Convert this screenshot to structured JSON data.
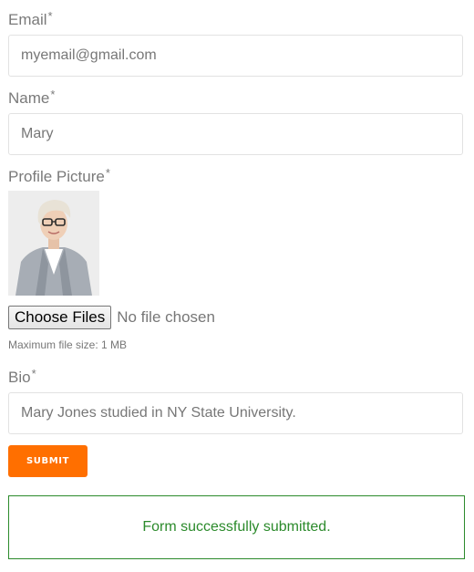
{
  "form": {
    "email": {
      "label": "Email",
      "required": "*",
      "value": "myemail@gmail.com"
    },
    "name": {
      "label": "Name",
      "required": "*",
      "value": "Mary"
    },
    "profile_picture": {
      "label": "Profile Picture",
      "required": "*",
      "choose_button": "Choose Files",
      "file_status": "No file chosen",
      "hint": "Maximum file size: 1 MB"
    },
    "bio": {
      "label": "Bio",
      "required": "*",
      "value": "Mary Jones studied in NY State University."
    },
    "submit_label": "SUBMIT",
    "success_message": "Form successfully submitted."
  },
  "colors": {
    "submit_bg": "#ff6f00",
    "success": "#2b8a2b",
    "label": "#7a7a7a",
    "border": "#e2e2e2"
  }
}
